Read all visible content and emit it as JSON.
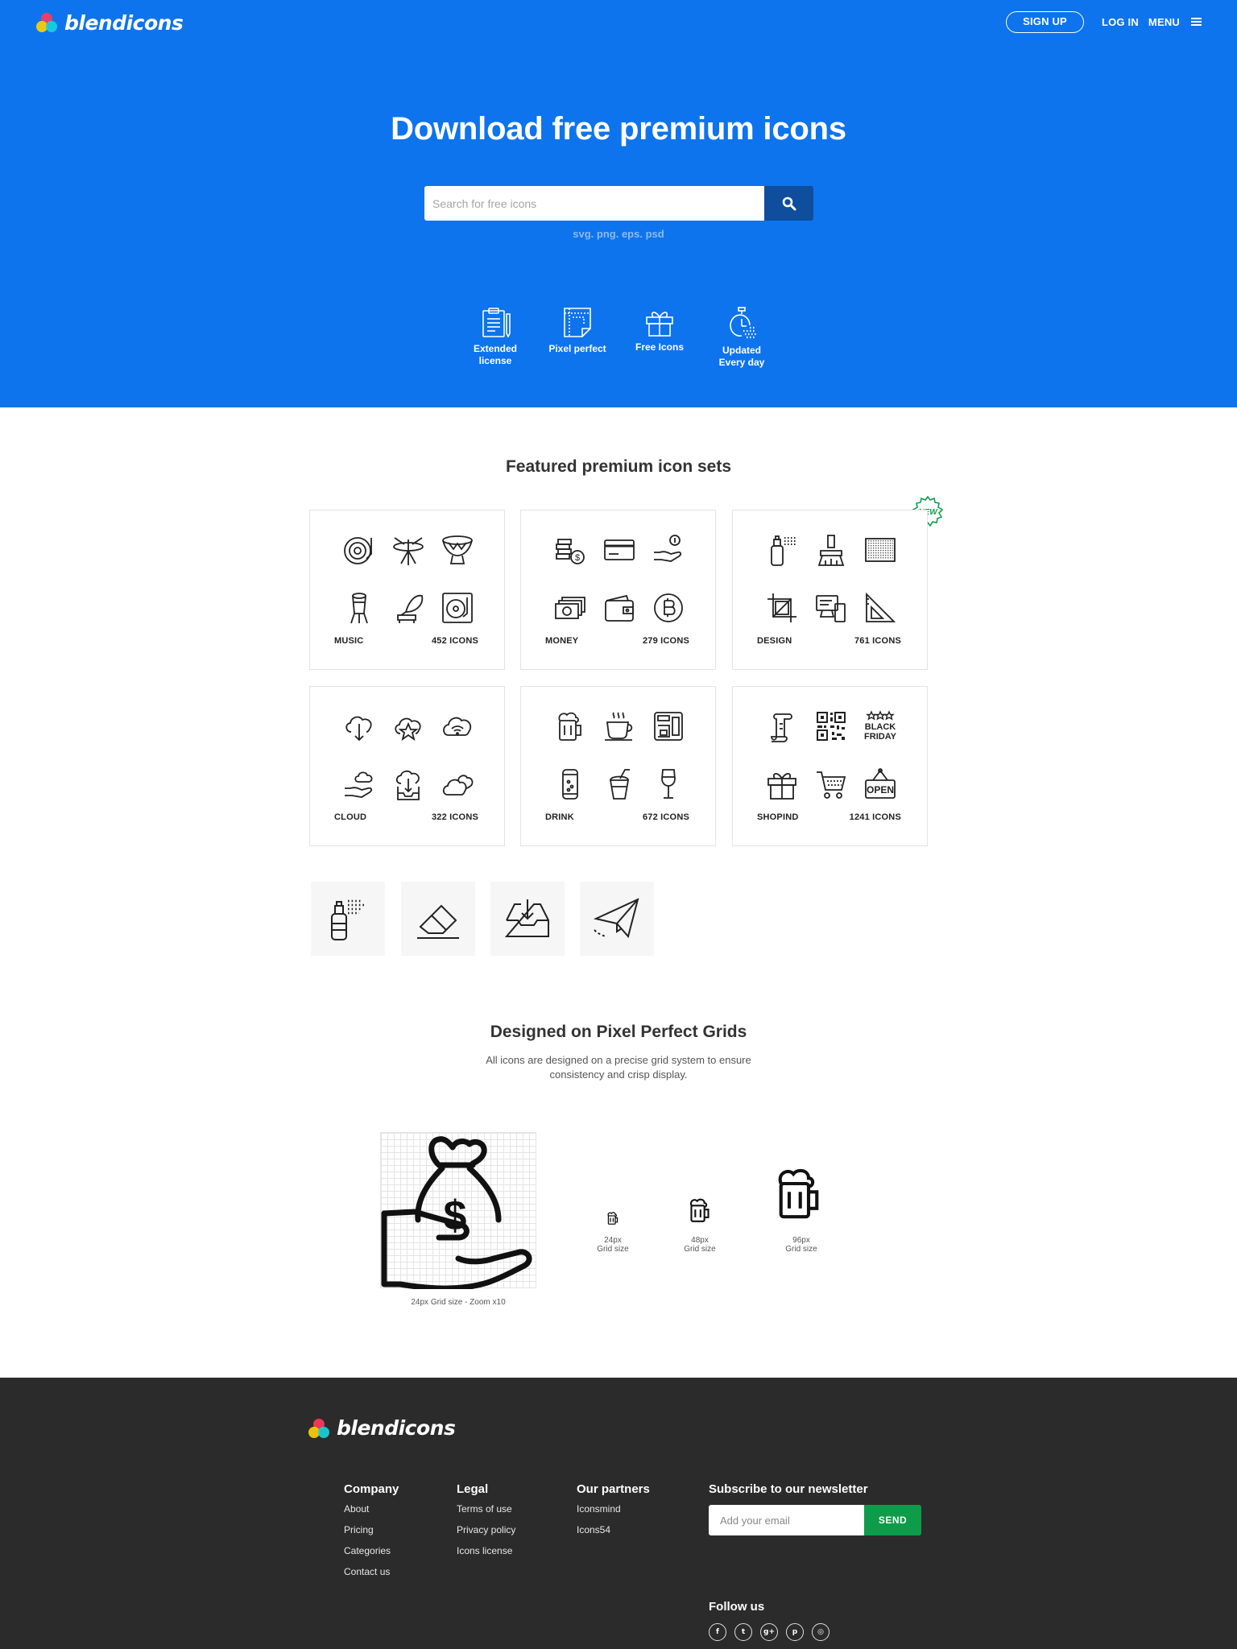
{
  "brand": {
    "name": "blendicons"
  },
  "nav": {
    "signup": "SIGN UP",
    "login": "LOG IN",
    "menu": "MENU"
  },
  "hero": {
    "title": "Download free premium icons",
    "search_placeholder": "Search for free icons",
    "formats": "svg. png. eps. psd",
    "features": [
      {
        "label": "Extended\nlicense",
        "icon": "license-icon"
      },
      {
        "label": "Pixel perfect",
        "icon": "pixel-perfect-icon"
      },
      {
        "label": "Free Icons",
        "icon": "gift-icon"
      },
      {
        "label": "Updated\nEvery day",
        "icon": "stopwatch-icon"
      }
    ]
  },
  "featured": {
    "title": "Featured premium icon sets",
    "badge": "NEW",
    "sets": [
      {
        "name": "MUSIC",
        "count": "452 ICONS"
      },
      {
        "name": "MONEY",
        "count": "279 ICONS"
      },
      {
        "name": "DESIGN",
        "count": "761 ICONS"
      },
      {
        "name": "CLOUD",
        "count": "322 ICONS"
      },
      {
        "name": "DRINK",
        "count": "672 ICONS"
      },
      {
        "name": "SHOPIND",
        "count": "1241 ICONS"
      }
    ],
    "tiles": [
      "spray-bottle-icon",
      "eraser-icon",
      "inbox-download-icon",
      "paper-plane-icon"
    ]
  },
  "grids": {
    "title": "Designed on Pixel Perfect Grids",
    "subtitle_1": "All icons are designed on a precise grid system to ensure",
    "subtitle_2": "consistency and crisp display.",
    "zoom_caption": "24px Grid size - Zoom x10",
    "sizes": [
      {
        "size": "24px",
        "label": "Grid size"
      },
      {
        "size": "48px",
        "label": "Grid size"
      },
      {
        "size": "96px",
        "label": "Grid size"
      }
    ],
    "stencil_text": [
      "BLACK",
      "FRIDAY",
      "OPEN"
    ]
  },
  "footer": {
    "columns": [
      {
        "title": "Company",
        "links": [
          "About",
          "Pricing",
          "Categories",
          "Contact us"
        ]
      },
      {
        "title": "Legal",
        "links": [
          "Terms of use",
          "Privacy policy",
          "Icons license"
        ]
      },
      {
        "title": "Our partners",
        "links": [
          "Iconsmind",
          "Icons54"
        ]
      }
    ],
    "newsletter": {
      "title": "Subscribe to our newsletter",
      "placeholder": "Add your email",
      "button": "SEND"
    },
    "follow": "Follow us",
    "socials": [
      {
        "icon": "facebook-icon",
        "glyph": "f"
      },
      {
        "icon": "twitter-icon",
        "glyph": "t"
      },
      {
        "icon": "google-plus-icon",
        "glyph": "g+"
      },
      {
        "icon": "pinterest-icon",
        "glyph": "p"
      },
      {
        "icon": "dribbble-icon",
        "glyph": "◎"
      }
    ]
  },
  "colors": {
    "brand_blue": "#0d74ed",
    "search_button": "#0f4d9d",
    "footer_bg": "#2b2b2b",
    "send_green": "#0e9c4b",
    "new_badge": "#0e9c4b"
  }
}
